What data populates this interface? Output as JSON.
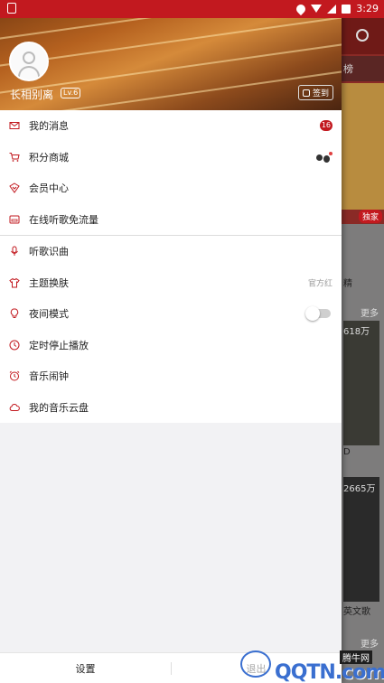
{
  "status_bar": {
    "time": "3:29"
  },
  "profile": {
    "username": "长相别离",
    "level": "Lv.6",
    "checkin_label": "签到"
  },
  "menu": {
    "group1": [
      {
        "label": "我的消息",
        "icon": "mail-icon",
        "badge": "16"
      },
      {
        "label": "积分商城",
        "icon": "cart-icon"
      },
      {
        "label": "会员中心",
        "icon": "vip-icon"
      },
      {
        "label": "在线听歌免流量",
        "icon": "sim-icon"
      }
    ],
    "group2": [
      {
        "label": "听歌识曲",
        "icon": "mic-icon"
      },
      {
        "label": "主题换肤",
        "icon": "shirt-icon",
        "value": "官方红"
      },
      {
        "label": "夜间模式",
        "icon": "bulb-icon",
        "toggle_on": false
      },
      {
        "label": "定时停止播放",
        "icon": "clock-icon"
      },
      {
        "label": "音乐闹钟",
        "icon": "alarm-icon"
      },
      {
        "label": "我的音乐云盘",
        "icon": "cloud-icon"
      }
    ]
  },
  "footer": {
    "settings_label": "设置",
    "exit_label": "退出"
  },
  "background_app": {
    "tab_partial": "榜",
    "banner_tag": "独家",
    "text1": "精",
    "more1": "更多",
    "count1": "618万",
    "title1": "D",
    "count2": "2665万",
    "title2": "英文歌",
    "more2": "更多"
  },
  "watermark": {
    "top": "腾牛网",
    "text": "QQTN.com"
  },
  "colors": {
    "accent": "#c2191f",
    "drawer_bg": "#f2f2f4"
  }
}
